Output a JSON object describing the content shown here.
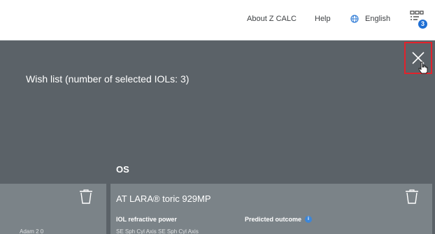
{
  "header": {
    "about_label": "About Z CALC",
    "help_label": "Help",
    "language_label": "English",
    "language_icon": "globe-icon",
    "wishlist_icon": "wishlist-icon",
    "wishlist_count": "3"
  },
  "overlay": {
    "title": "Wish list (number of selected IOLs: 3)",
    "close_icon": "close-icon",
    "eye_label": "OS"
  },
  "cards": {
    "left": {
      "partial_text": "Adam 2 0"
    },
    "main": {
      "title": "AT LARA® toric 929MP",
      "power_label": "IOL refractive power",
      "outcome_label": "Predicted outcome",
      "info_icon": "i",
      "partial_text": "SE    Sph    Cyl    Axis    SE    Sph    Cyl    Axis"
    }
  },
  "colors": {
    "overlay_bg": "#5b6268",
    "card_bg": "#7b8388",
    "highlight": "#e3222b",
    "accent": "#1f6fd4"
  }
}
